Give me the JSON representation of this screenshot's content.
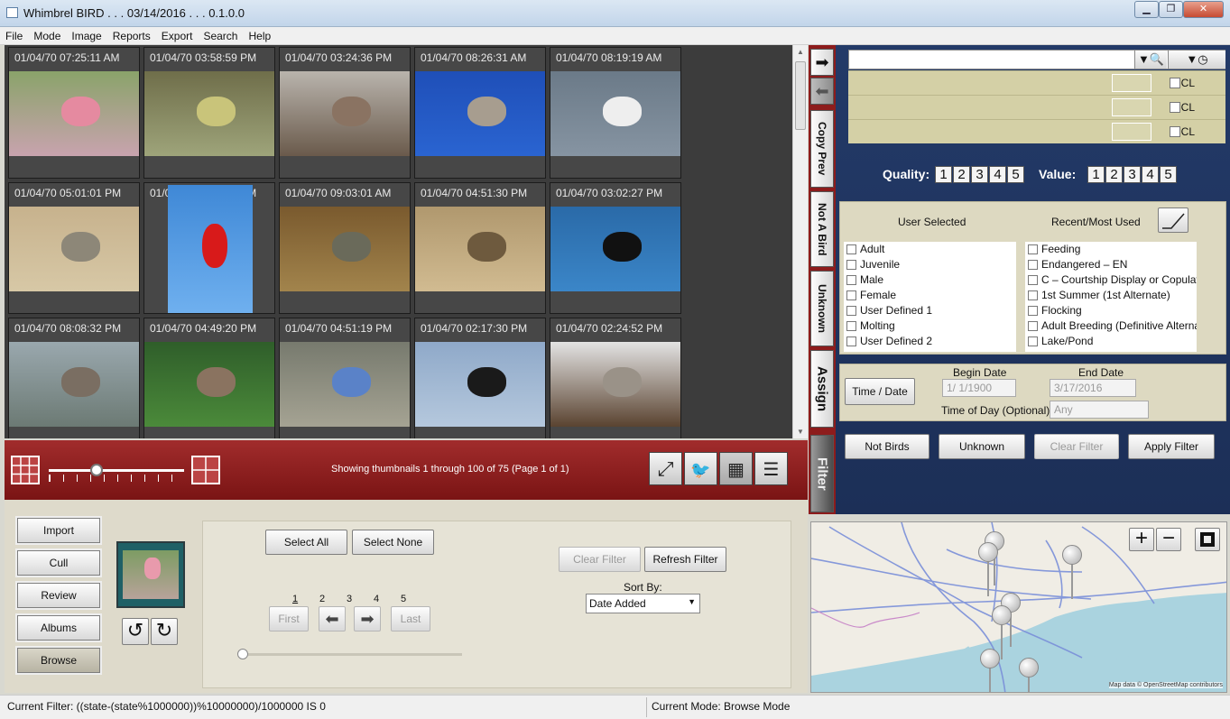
{
  "window": {
    "title": "Whimbrel BIRD . . . 03/14/2016 . . . 0.1.0.0"
  },
  "menu": [
    "File",
    "Mode",
    "Image",
    "Reports",
    "Export",
    "Search",
    "Help"
  ],
  "thumbnails": [
    {
      "ts": "01/04/70 07:25:11 AM",
      "c1": "#8aa36a",
      "c2": "#c8a3ae",
      "accent": "#e58aa0"
    },
    {
      "ts": "01/04/70 03:58:59 PM",
      "c1": "#6f6e4a",
      "c2": "#9ea47a",
      "accent": "#c9c47a"
    },
    {
      "ts": "01/04/70 03:24:36 PM",
      "c1": "#b9b4ad",
      "c2": "#6a5a4b",
      "accent": "#8a7362"
    },
    {
      "ts": "01/04/70 08:26:31 AM",
      "c1": "#1f4fb8",
      "c2": "#2a64d1",
      "accent": "#a79d8f"
    },
    {
      "ts": "01/04/70 08:19:19 AM",
      "c1": "#6b7a88",
      "c2": "#8694a2",
      "accent": "#eeeeee"
    },
    {
      "ts": "01/04/70 05:01:01 PM",
      "c1": "#c7b28d",
      "c2": "#d7c8a6",
      "accent": "#8d8778"
    },
    {
      "ts": "01/04/70 01:46:58 PM",
      "c1": "#3f88d6",
      "c2": "#6fb0ef",
      "accent": "#d81a1a",
      "narrow": true
    },
    {
      "ts": "01/04/70 09:03:01 AM",
      "c1": "#7a5a2e",
      "c2": "#a2844c",
      "accent": "#6a6a5a"
    },
    {
      "ts": "01/04/70 04:51:30 PM",
      "c1": "#b0986e",
      "c2": "#d1bb91",
      "accent": "#6e5a3e"
    },
    {
      "ts": "01/04/70 03:02:27 PM",
      "c1": "#2a6aa8",
      "c2": "#3b86c8",
      "accent": "#111111"
    },
    {
      "ts": "01/04/70 08:08:32 PM",
      "c1": "#9aa8ae",
      "c2": "#6c7a74",
      "accent": "#7a6e62"
    },
    {
      "ts": "01/04/70 04:49:20 PM",
      "c1": "#2f5e2a",
      "c2": "#4b8a3a",
      "accent": "#8a7360"
    },
    {
      "ts": "01/04/70 04:51:19 PM",
      "c1": "#777a6e",
      "c2": "#a5a393",
      "accent": "#5a82c8"
    },
    {
      "ts": "01/04/70 02:17:30 PM",
      "c1": "#8fa9c9",
      "c2": "#b5c8dd",
      "accent": "#1a1a1a"
    },
    {
      "ts": "01/04/70 02:24:52 PM",
      "c1": "#e3e3e3",
      "c2": "#5a4330",
      "accent": "#9a9288"
    }
  ],
  "vtabs": {
    "copy_prev": "Copy Prev",
    "not_a_bird": "Not A Bird",
    "unknown": "Unknown",
    "assign": "Assign",
    "filter": "Filter"
  },
  "keywords": {
    "rows": [
      {
        "cl": "CL"
      },
      {
        "cl": "CL"
      },
      {
        "cl": "CL"
      }
    ]
  },
  "rating": {
    "quality_label": "Quality:",
    "value_label": "Value:",
    "options": [
      "1",
      "2",
      "3",
      "4",
      "5"
    ]
  },
  "attributes": {
    "user_selected_header": "User Selected",
    "recent_header": "Recent/Most Used",
    "left": [
      "Adult",
      "Juvenile",
      "Male",
      "Female",
      "User Defined 1",
      "Molting",
      "User Defined 2"
    ],
    "right": [
      "Feeding",
      "Endangered – EN",
      "C – Courtship Display or Copulati",
      "1st Summer (1st Alternate)",
      "Flocking",
      "Adult Breeding (Definitive Alterna",
      "Lake/Pond"
    ]
  },
  "dates": {
    "time_date_button": "Time / Date",
    "begin_label": "Begin Date",
    "end_label": "End Date",
    "begin_value": "1/  1/1900",
    "end_value": "3/17/2016",
    "time_of_day_label": "Time of Day (Optional)",
    "time_of_day_value": "Any"
  },
  "filter_buttons": {
    "not_birds": "Not Birds",
    "unknown": "Unknown",
    "clear_filter": "Clear Filter",
    "apply_filter": "Apply Filter"
  },
  "toolbar": {
    "status": "Showing thumbnails 1 through 100 of 75 (Page 1 of 1)",
    "zoom_level": 0.35
  },
  "nav": [
    "Import",
    "Cull",
    "Review",
    "Albums",
    "Browse"
  ],
  "browse": {
    "select_all": "Select All",
    "select_none": "Select None",
    "pages": [
      "1",
      "2",
      "3",
      "4",
      "5"
    ],
    "first": "First",
    "last": "Last",
    "clear_filter": "Clear Filter",
    "refresh_filter": "Refresh Filter",
    "sort_by_label": "Sort By:",
    "sort_by_value": "Date Added"
  },
  "map": {
    "credit": "Map data © OpenStreetMap contributors"
  },
  "status": {
    "current_filter": "Current Filter:  ((state-(state%1000000))%10000000)/1000000 IS 0",
    "current_mode": "Current Mode: Browse Mode"
  }
}
